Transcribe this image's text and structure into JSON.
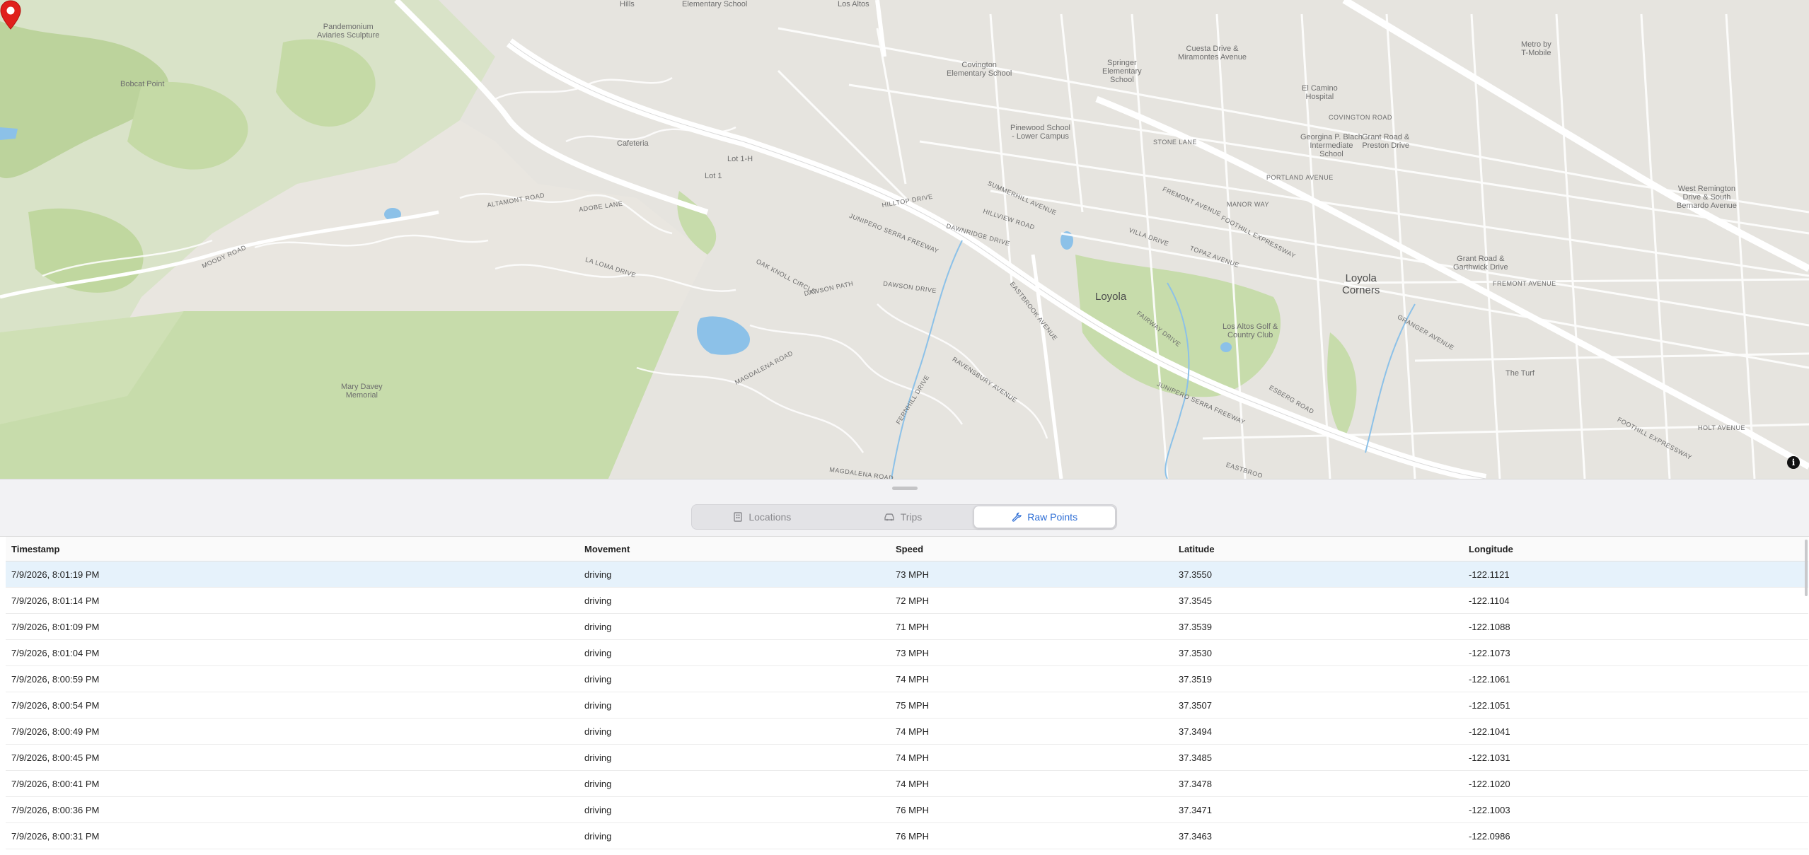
{
  "map": {
    "labels": {
      "hills": "Hills",
      "elementary_school_top": "Elementary School",
      "los_altos": "Los Altos",
      "pandemonium": "Pandemonium\nAviaries Sculpture",
      "bobcat_point": "Bobcat Point",
      "covington": "Covington\nElementary School",
      "springer": "Springer\nElementary\nSchool",
      "cuesta": "Cuesta Drive &\nMiramontes Avenue",
      "metro": "Metro by\nT-Mobile",
      "el_camino": "El Camino\nHospital",
      "georgina": "Georgina P. Blach\nIntermediate\nSchool",
      "grant_preston": "Grant Road &\nPreston Drive",
      "pinewood": "Pinewood School\n- Lower Campus",
      "cafeteria": "Cafeteria",
      "lot_1h": "Lot 1-H",
      "lot_1": "Lot 1",
      "west_remington": "West Remington\nDrive & South\nBernardo Avenue",
      "grant_garthwick": "Grant Road &\nGarthwick Drive",
      "loyola_corners": "Loyola\nCorners",
      "loyola": "Loyola",
      "los_altos_golf": "Los Altos Golf &\nCountry Club",
      "the_turf": "The Turf",
      "mary_davey": "Mary Davey\nMemorial"
    },
    "streets": {
      "junipero_1": "JUNIPERO SERRA FREEWAY",
      "junipero_2": "JUNIPERO SERRA FREEWAY",
      "foothill": "FOOTHILL EXPRESSWAY",
      "foothill_2": "FOOTHILL EXPRESSWAY",
      "fremont": "FREMONT AVENUE",
      "fremont_2": "FREMONT AVENUE",
      "eastbrook": "EASTBROOK AVENUE",
      "moody": "MOODY ROAD",
      "altamont": "ALTAMONT ROAD",
      "adobe": "ADOBE LANE",
      "dawson_path": "DAWSON PATH",
      "dawson_drive": "DAWSON DRIVE",
      "oak_knoll": "OAK KNOLL CIRCLE",
      "la_loma": "LA LOMA DRIVE",
      "magdalena": "MAGDALENA ROAD",
      "magdalena_2": "MAGDALENA ROAD",
      "ravensbury": "RAVENSBURY AVENUE",
      "fernhill": "FERNHILL DRIVE",
      "fairway": "FAIRWAY DRIVE",
      "esberg": "ESBERG ROAD",
      "granger": "GRANGER AVENUE",
      "hilltop": "HILLTOP DRIVE",
      "hillview": "HILLVIEW ROAD",
      "dawnridge": "DAWNRIDGE DRIVE",
      "summerhill": "SUMMERHILL AVENUE",
      "portland": "PORTLAND AVENUE",
      "covington_road": "COVINGTON ROAD",
      "manor_way": "MANOR WAY",
      "topaz": "TOPAZ AVENUE",
      "villa": "VILLA DRIVE",
      "holt": "HOLT AVENUE",
      "stone": "STONE LANE",
      "eastbrook_2": "EASTBROO"
    },
    "attribution_icon": "info-icon"
  },
  "tabs": [
    {
      "label": "Locations",
      "icon": "building-icon",
      "active": false
    },
    {
      "label": "Trips",
      "icon": "car-icon",
      "active": false
    },
    {
      "label": "Raw Points",
      "icon": "wrench-icon",
      "active": true
    }
  ],
  "table": {
    "headers": [
      "Timestamp",
      "Movement",
      "Speed",
      "Latitude",
      "Longitude"
    ],
    "rows": [
      [
        "7/9/2026, 8:01:19 PM",
        "driving",
        "73 MPH",
        "37.3550",
        "-122.1121"
      ],
      [
        "7/9/2026, 8:01:14 PM",
        "driving",
        "72 MPH",
        "37.3545",
        "-122.1104"
      ],
      [
        "7/9/2026, 8:01:09 PM",
        "driving",
        "71 MPH",
        "37.3539",
        "-122.1088"
      ],
      [
        "7/9/2026, 8:01:04 PM",
        "driving",
        "73 MPH",
        "37.3530",
        "-122.1073"
      ],
      [
        "7/9/2026, 8:00:59 PM",
        "driving",
        "74 MPH",
        "37.3519",
        "-122.1061"
      ],
      [
        "7/9/2026, 8:00:54 PM",
        "driving",
        "75 MPH",
        "37.3507",
        "-122.1051"
      ],
      [
        "7/9/2026, 8:00:49 PM",
        "driving",
        "74 MPH",
        "37.3494",
        "-122.1041"
      ],
      [
        "7/9/2026, 8:00:45 PM",
        "driving",
        "74 MPH",
        "37.3485",
        "-122.1031"
      ],
      [
        "7/9/2026, 8:00:41 PM",
        "driving",
        "74 MPH",
        "37.3478",
        "-122.1020"
      ],
      [
        "7/9/2026, 8:00:36 PM",
        "driving",
        "76 MPH",
        "37.3471",
        "-122.1003"
      ],
      [
        "7/9/2026, 8:00:31 PM",
        "driving",
        "76 MPH",
        "37.3463",
        "-122.0986"
      ]
    ],
    "selected_row": 0
  },
  "colors": {
    "accent": "#2f6fd6",
    "pin": "#e0201c",
    "selected_row": "#e6f2fb",
    "park": "#c7dcab",
    "water": "#8cc1e8"
  }
}
